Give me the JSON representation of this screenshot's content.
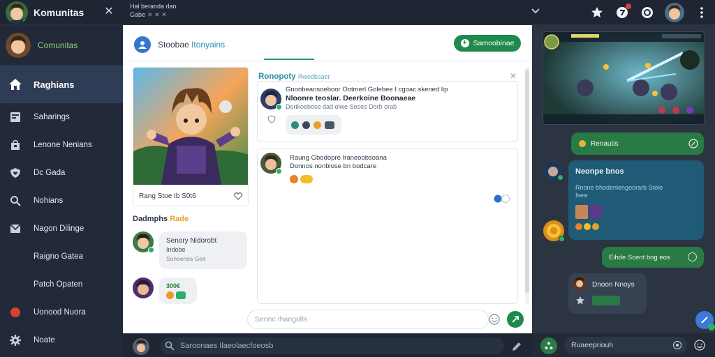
{
  "app": {
    "title": "Komunitas",
    "top_tabs_line1": "Hal beranda dan",
    "top_tabs_line2": "Gabe"
  },
  "sidebar": {
    "profile_name": "Comunitas",
    "items": [
      {
        "label": "Raghians",
        "icon": "home-icon"
      },
      {
        "label": "Saharings",
        "icon": "document-icon"
      },
      {
        "label": "Lenone Nenians",
        "icon": "bag-icon"
      },
      {
        "label": "Dc Gada",
        "icon": "shield-heart-icon"
      },
      {
        "label": "Nohians",
        "icon": "search-icon"
      },
      {
        "label": "Nagon Dilinge",
        "icon": "mail-icon"
      },
      {
        "label": "Raigno Gatea",
        "icon": "none"
      },
      {
        "label": "Patch Opaten",
        "icon": "none"
      },
      {
        "label": "Uonood Nuora",
        "icon": "red-dot-icon"
      },
      {
        "label": "Noate",
        "icon": "gear-icon"
      }
    ]
  },
  "center": {
    "header_title": "Stoobae",
    "header_accent": "Itonyains",
    "primary_button": "Samoobinae",
    "hero_caption": "Rang Stoe Ib S0t6",
    "section_title": "Dadmphs",
    "section_highlight": "Rade",
    "comments": [
      {
        "line1": "Senory Nidorobt",
        "line2": "Indobe",
        "line3": "Sonoenos Geit"
      },
      {
        "points": "300€"
      }
    ],
    "feed_title": "Ronopoty",
    "feed_title_small": "Rwodbsaer",
    "post1": {
      "line1": "Gnonbeansoeboor Ootmerl Golebee I cgoac skened lip",
      "line2": "Nloonre teoslar. Deerkoine Boonaeae",
      "line3": "Dorikoebose dad olwe Soses Dorb orab"
    },
    "post2": {
      "line1": "Raung Gbodopre Iraneoobsoana",
      "line2": "Donnos nonblose bn bodcare"
    },
    "comment_placeholder": "Sennc Ihangolts"
  },
  "bottombar": {
    "search_placeholder": "Saroonaes Ilaeolaecfoeosb"
  },
  "chat": {
    "m1": "Renautis",
    "m2_title": "Neonpe bnos",
    "m2_sub": "Rnone bhodenlengoorarb Stole",
    "m2_sub2": "Isea",
    "m3": "Eihde Scent bog eos",
    "m4": "Dnoon Nnoys",
    "input_value": "Ruaeepriouh"
  },
  "colors": {
    "accent_green": "#1e8a4d",
    "accent_blue": "#3776c9",
    "sidebar_bg": "#222a39",
    "chat_bg": "#2c3441"
  }
}
